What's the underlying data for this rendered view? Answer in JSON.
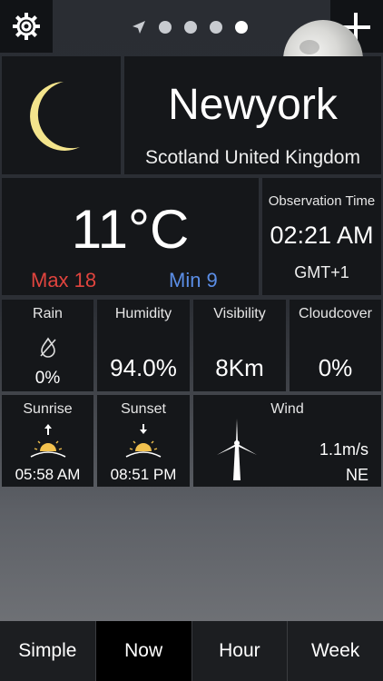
{
  "page_indicator": {
    "pages": 4,
    "active_index": 3
  },
  "location": {
    "city": "Newyork",
    "region": "Scotland United Kingdom"
  },
  "current": {
    "temperature": "11°C",
    "max": "Max 18",
    "min": "Min 9",
    "max_color": "#e0443e",
    "min_color": "#5b8ee6"
  },
  "observation": {
    "title": "Observation Time",
    "time": "02:21 AM",
    "tz": "GMT+1"
  },
  "stats": {
    "rain": {
      "label": "Rain",
      "value": "0%"
    },
    "humidity": {
      "label": "Humidity",
      "value": "94.0%"
    },
    "visibility": {
      "label": "Visibility",
      "value": "8Km"
    },
    "cloudcover": {
      "label": "Cloudcover",
      "value": "0%"
    }
  },
  "sun": {
    "sunrise": {
      "label": "Sunrise",
      "value": "05:58 AM"
    },
    "sunset": {
      "label": "Sunset",
      "value": "08:51 PM"
    }
  },
  "wind": {
    "label": "Wind",
    "speed": "1.1m/s",
    "direction": "NE"
  },
  "tabs": [
    {
      "label": "Simple"
    },
    {
      "label": "Now"
    },
    {
      "label": "Hour"
    },
    {
      "label": "Week"
    }
  ],
  "icons": {
    "settings": "gear-icon",
    "location": "location-arrow-icon",
    "add": "plus-icon",
    "weather": "crescent-moon-icon",
    "rain": "no-rain-icon",
    "sunrise": "sunrise-icon",
    "sunset": "sunset-icon",
    "wind": "wind-turbine-icon"
  }
}
